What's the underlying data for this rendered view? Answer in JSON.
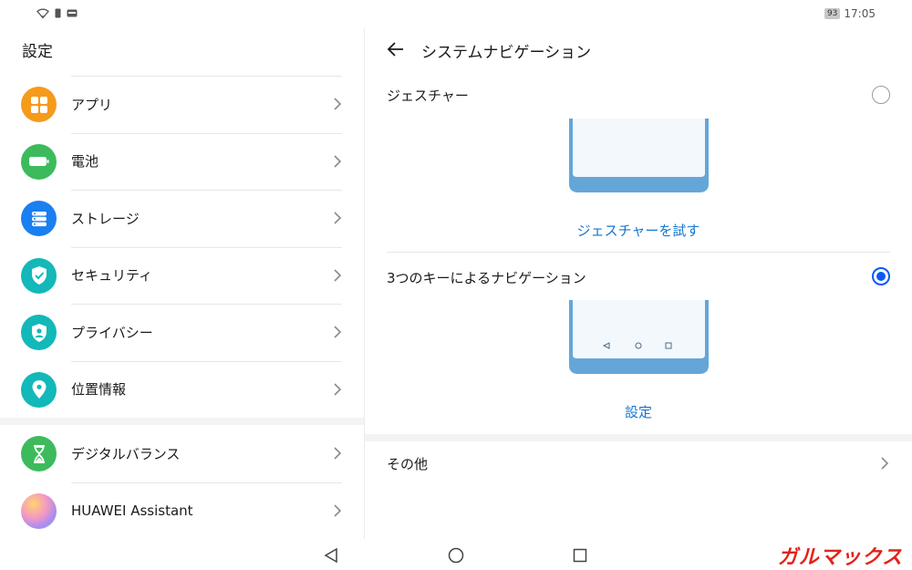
{
  "status_bar": {
    "icons": [
      "wifi-icon",
      "sim-icon",
      "card-icon"
    ],
    "battery": "93",
    "time": "17:05"
  },
  "left_pane": {
    "title": "設定",
    "items": [
      {
        "label": "アプリ",
        "icon": "apps-icon",
        "color": "#f59b1b"
      },
      {
        "label": "電池",
        "icon": "battery-icon",
        "color": "#3dbb5c"
      },
      {
        "label": "ストレージ",
        "icon": "storage-icon",
        "color": "#1a7ff0"
      },
      {
        "label": "セキュリティ",
        "icon": "shield-icon",
        "color": "#13b8b8"
      },
      {
        "label": "プライバシー",
        "icon": "privacy-icon",
        "color": "#13b8b8"
      },
      {
        "label": "位置情報",
        "icon": "location-icon",
        "color": "#13b8b8"
      },
      {
        "label": "デジタルバランス",
        "icon": "hourglass-icon",
        "color": "#3dbb5c"
      },
      {
        "label": "HUAWEI Assistant",
        "icon": "assistant-icon",
        "color": "#e98ac8"
      }
    ]
  },
  "right_pane": {
    "title": "システムナビゲーション",
    "gesture": {
      "label": "ジェスチャー",
      "selected": false,
      "try_link": "ジェスチャーを試す"
    },
    "three_key": {
      "label": "3つのキーによるナビゲーション",
      "selected": true,
      "settings_link": "設定"
    },
    "other": {
      "label": "その他"
    }
  },
  "colors": {
    "accent": "#0a59f7",
    "link": "#1475d0",
    "phone_frame": "#65a6d8"
  },
  "watermark": "ガルマックス"
}
